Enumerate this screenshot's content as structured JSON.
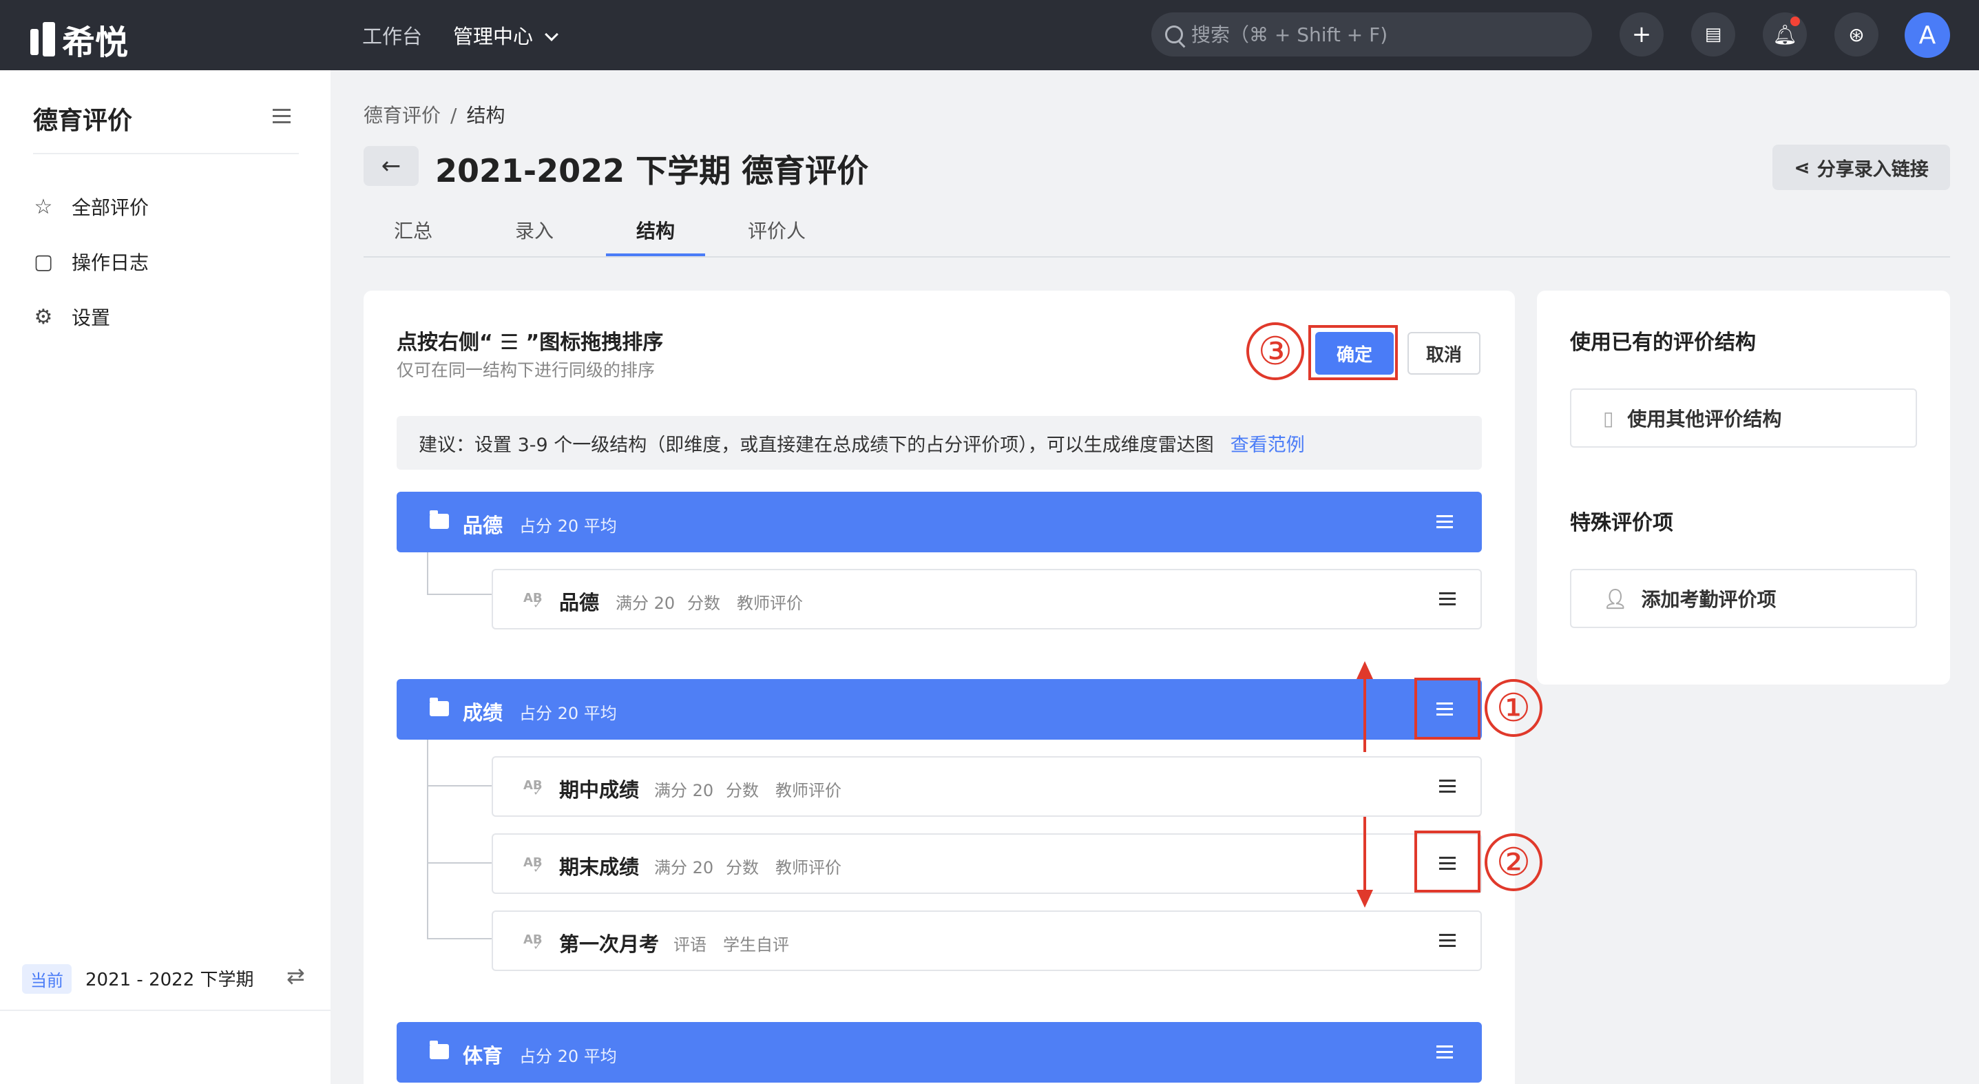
{
  "topbar": {
    "logo_text": "希悦",
    "nav": [
      {
        "label": "工作台"
      },
      {
        "label": "管理中心"
      }
    ],
    "search_placeholder": "搜索（⌘ + Shift + F)",
    "avatar_letter": "A"
  },
  "sidebar": {
    "title": "德育评价",
    "items": [
      {
        "label": "全部评价",
        "icon": "star-icon"
      },
      {
        "label": "操作日志",
        "icon": "log-icon"
      },
      {
        "label": "设置",
        "icon": "gear-icon"
      }
    ],
    "term_badge": "当前",
    "term_text": "2021 - 2022 下学期"
  },
  "breadcrumb": {
    "root": "德育评价",
    "sep": "/",
    "current": "结构"
  },
  "page_title": "2021-2022 下学期 德育评价",
  "share_label": "分享录入链接",
  "tabs": [
    {
      "label": "汇总"
    },
    {
      "label": "录入"
    },
    {
      "label": "结构"
    },
    {
      "label": "评价人"
    }
  ],
  "structure": {
    "hint_title": "点按右侧“ ☰ ”图标拖拽排序",
    "hint_sub": "仅可在同一结构下进行同级的排序",
    "confirm_label": "确定",
    "cancel_label": "取消",
    "tip_text": "建议：设置 3-9 个一级结构（即维度，或直接建在总成绩下的占分评价项），可以生成维度雷达图",
    "tip_link": "查看范例",
    "groups": [
      {
        "name": "品德",
        "meta": "占分 20 平均",
        "items": [
          {
            "name": "品德",
            "meta": [
              "满分 20",
              "分数",
              "教师评价"
            ]
          }
        ]
      },
      {
        "name": "成绩",
        "meta": "占分 20 平均",
        "items": [
          {
            "name": "期中成绩",
            "meta": [
              "满分 20",
              "分数",
              "教师评价"
            ]
          },
          {
            "name": "期末成绩",
            "meta": [
              "满分 20",
              "分数",
              "教师评价"
            ]
          },
          {
            "name": "第一次月考",
            "meta": [
              "评语",
              "学生自评"
            ]
          }
        ]
      },
      {
        "name": "体育",
        "meta": "占分 20 平均",
        "items": []
      }
    ],
    "annotations": [
      "①",
      "②",
      "③"
    ]
  },
  "side_panel": {
    "existing_title": "使用已有的评价结构",
    "existing_btn": "使用其他评价结构",
    "special_title": "特殊评价项",
    "special_btn": "添加考勤评价项"
  },
  "colors": {
    "accent": "#4a7cf7",
    "annotation": "#e0392b",
    "topbar": "#2b2e36"
  }
}
